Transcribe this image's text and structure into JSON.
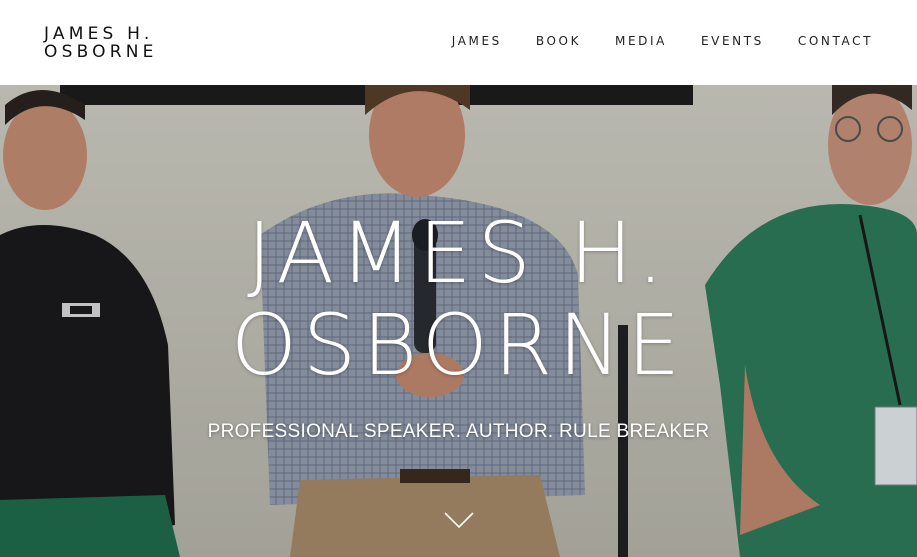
{
  "header": {
    "logo_line1": "JAMES H.",
    "logo_line2": "OSBORNE",
    "nav": [
      {
        "label": "JAMES"
      },
      {
        "label": "BOOK"
      },
      {
        "label": "MEDIA"
      },
      {
        "label": "EVENTS"
      },
      {
        "label": "CONTACT"
      }
    ]
  },
  "hero": {
    "title_line1": "JAMES H.",
    "title_line2": "OSBORNE",
    "tagline": "PROFESSIONAL SPEAKER. AUTHOR. RULE BREAKER",
    "scroll_icon": "chevron-down-icon",
    "background_image": "panel-discussion-photo"
  },
  "colors": {
    "header_bg": "#ffffff",
    "text_dark": "#111111",
    "hero_text": "#ffffff",
    "scrub_green": "#2e7d5b",
    "wall": "#c9c9bf"
  }
}
